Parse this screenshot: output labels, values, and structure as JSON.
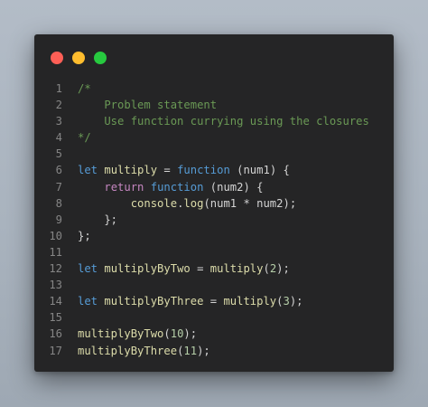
{
  "colors": {
    "background": "#a9b3be",
    "window": "#252526",
    "close_dot": "#ff5f56",
    "minimize_dot": "#ffbd2e",
    "maximize_dot": "#27c93f",
    "comment": "#6a9955",
    "keyword": "#569cd6",
    "control": "#c586c0",
    "function": "#dcdcaa",
    "number": "#b5cea8",
    "text": "#d4d4d4",
    "line_number": "#858585"
  },
  "window_controls": [
    {
      "name": "close-dot",
      "color": "#ff5f56"
    },
    {
      "name": "minimize-dot",
      "color": "#ffbd2e"
    },
    {
      "name": "maximize-dot",
      "color": "#27c93f"
    }
  ],
  "code": {
    "lines": [
      {
        "num": "1",
        "tokens": [
          {
            "t": "/*",
            "c": "comment"
          }
        ]
      },
      {
        "num": "2",
        "tokens": [
          {
            "t": "    Problem statement",
            "c": "comment"
          }
        ]
      },
      {
        "num": "3",
        "tokens": [
          {
            "t": "    Use function currying using the closures",
            "c": "comment"
          }
        ]
      },
      {
        "num": "4",
        "tokens": [
          {
            "t": "*/",
            "c": "comment"
          }
        ]
      },
      {
        "num": "5",
        "tokens": []
      },
      {
        "num": "6",
        "tokens": [
          {
            "t": "let",
            "c": "keyword"
          },
          {
            "t": " ",
            "c": "punct"
          },
          {
            "t": "multiply",
            "c": "var"
          },
          {
            "t": " = ",
            "c": "punct"
          },
          {
            "t": "function",
            "c": "keyword"
          },
          {
            "t": " (",
            "c": "punct"
          },
          {
            "t": "num1",
            "c": "param"
          },
          {
            "t": ") {",
            "c": "punct"
          }
        ]
      },
      {
        "num": "7",
        "tokens": [
          {
            "t": "    ",
            "c": "punct"
          },
          {
            "t": "return",
            "c": "control"
          },
          {
            "t": " ",
            "c": "punct"
          },
          {
            "t": "function",
            "c": "keyword"
          },
          {
            "t": " (",
            "c": "punct"
          },
          {
            "t": "num2",
            "c": "param"
          },
          {
            "t": ") {",
            "c": "punct"
          }
        ]
      },
      {
        "num": "8",
        "tokens": [
          {
            "t": "        ",
            "c": "punct"
          },
          {
            "t": "console",
            "c": "var"
          },
          {
            "t": ".",
            "c": "punct"
          },
          {
            "t": "log",
            "c": "func"
          },
          {
            "t": "(num1 * num2);",
            "c": "punct"
          }
        ]
      },
      {
        "num": "9",
        "tokens": [
          {
            "t": "    };",
            "c": "punct"
          }
        ]
      },
      {
        "num": "10",
        "tokens": [
          {
            "t": "};",
            "c": "punct"
          }
        ]
      },
      {
        "num": "11",
        "tokens": []
      },
      {
        "num": "12",
        "tokens": [
          {
            "t": "let",
            "c": "keyword"
          },
          {
            "t": " ",
            "c": "punct"
          },
          {
            "t": "multiplyByTwo",
            "c": "var"
          },
          {
            "t": " = ",
            "c": "punct"
          },
          {
            "t": "multiply",
            "c": "func"
          },
          {
            "t": "(",
            "c": "punct"
          },
          {
            "t": "2",
            "c": "num"
          },
          {
            "t": ");",
            "c": "punct"
          }
        ]
      },
      {
        "num": "13",
        "tokens": []
      },
      {
        "num": "14",
        "tokens": [
          {
            "t": "let",
            "c": "keyword"
          },
          {
            "t": " ",
            "c": "punct"
          },
          {
            "t": "multiplyByThree",
            "c": "var"
          },
          {
            "t": " = ",
            "c": "punct"
          },
          {
            "t": "multiply",
            "c": "func"
          },
          {
            "t": "(",
            "c": "punct"
          },
          {
            "t": "3",
            "c": "num"
          },
          {
            "t": ");",
            "c": "punct"
          }
        ]
      },
      {
        "num": "15",
        "tokens": []
      },
      {
        "num": "16",
        "tokens": [
          {
            "t": "multiplyByTwo",
            "c": "func"
          },
          {
            "t": "(",
            "c": "punct"
          },
          {
            "t": "10",
            "c": "num"
          },
          {
            "t": ");",
            "c": "punct"
          }
        ]
      },
      {
        "num": "17",
        "tokens": [
          {
            "t": "multiplyByThree",
            "c": "func"
          },
          {
            "t": "(",
            "c": "punct"
          },
          {
            "t": "11",
            "c": "num"
          },
          {
            "t": ");",
            "c": "punct"
          }
        ]
      }
    ]
  }
}
